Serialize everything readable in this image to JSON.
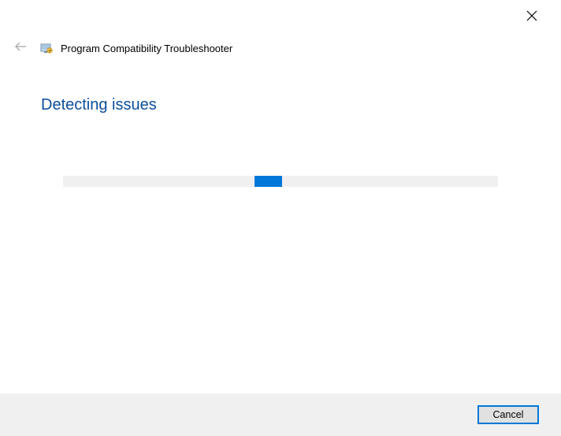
{
  "header": {
    "title": "Program Compatibility Troubleshooter"
  },
  "page": {
    "heading": "Detecting issues"
  },
  "footer": {
    "cancel_label": "Cancel"
  }
}
